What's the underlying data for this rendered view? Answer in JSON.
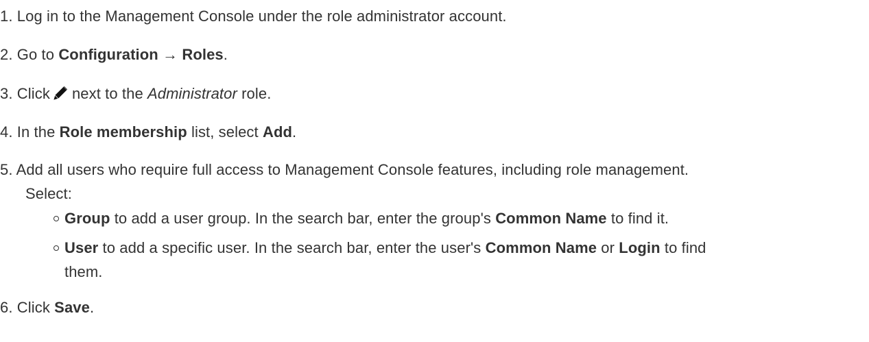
{
  "steps": [
    {
      "num": "1.",
      "text": "Log in to the Management Console under the role administrator account."
    },
    {
      "num": "2.",
      "pre": "Go to ",
      "b1": "Configuration",
      "arrow": "→",
      "b2": "Roles",
      "post": "."
    },
    {
      "num": "3.",
      "pre": "Click",
      "icon": "pencil-icon",
      "mid": "next to the ",
      "em": "Administrator",
      "post": " role."
    },
    {
      "num": "4.",
      "pre": "In the ",
      "b1": "Role membership",
      "mid": " list, select ",
      "b2": "Add",
      "post": "."
    },
    {
      "num": "5.",
      "text": "Add all users who require full access to Management Console features, including role management.",
      "text2": "Select:",
      "bullets": [
        {
          "b1": "Group",
          "t1": " to add a user group. In the search bar, enter the group's ",
          "b2": "Common Name",
          "t2": " to find it."
        },
        {
          "b1": "User",
          "t1": " to add a specific user. In the search bar, enter the user's ",
          "b2": "Common Name",
          "t2": " or ",
          "b3": "Login",
          "t3": " to find",
          "t4": "them."
        }
      ]
    },
    {
      "num": "6.",
      "pre": "Click ",
      "b1": "Save",
      "post": "."
    }
  ]
}
